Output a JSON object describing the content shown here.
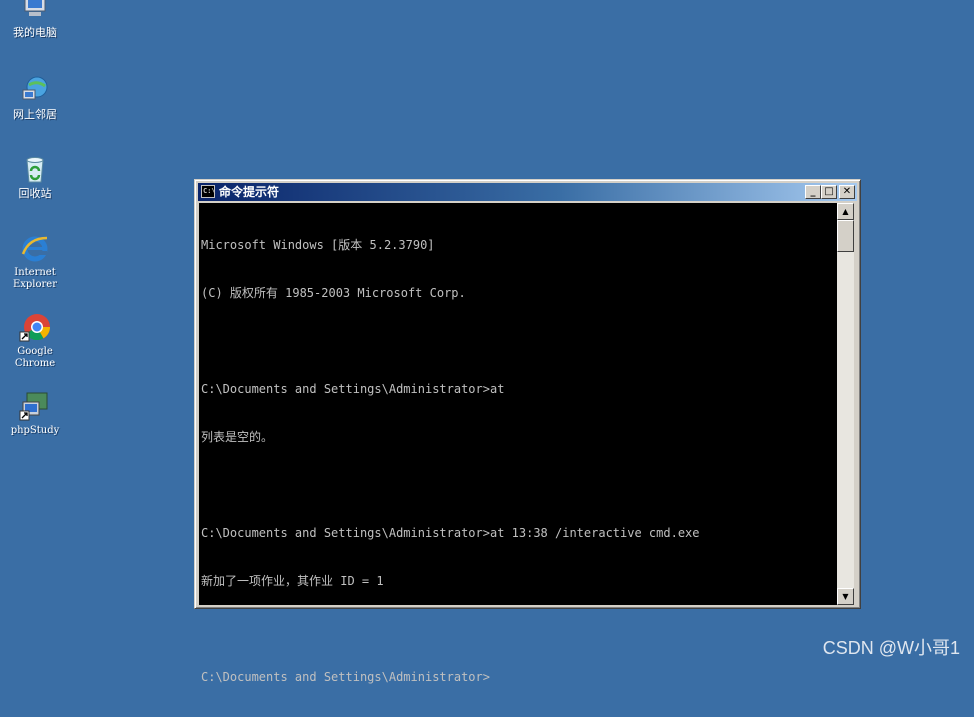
{
  "desktop": {
    "icons": [
      {
        "label": "我的电脑",
        "icon": "my-computer-icon"
      },
      {
        "label": "网上邻居",
        "icon": "network-places-icon"
      },
      {
        "label": "回收站",
        "icon": "recycle-bin-icon"
      },
      {
        "label_line1": "Internet",
        "label_line2": "Explorer",
        "icon": "internet-explorer-icon"
      },
      {
        "label_line1": "Google",
        "label_line2": "Chrome",
        "icon": "google-chrome-icon"
      },
      {
        "label": "phpStudy",
        "icon": "phpstudy-icon"
      }
    ]
  },
  "window": {
    "title": "命令提示符",
    "icon": "console-icon",
    "buttons": {
      "minimize": "_",
      "maximize": "□",
      "close": "✕"
    }
  },
  "console": {
    "lines": [
      "Microsoft Windows [版本 5.2.3790]",
      "(C) 版权所有 1985-2003 Microsoft Corp.",
      "",
      "C:\\Documents and Settings\\Administrator>at",
      "列表是空的。",
      "",
      "C:\\Documents and Settings\\Administrator>at 13:38 /interactive cmd.exe",
      "新加了一项作业，其作业 ID = 1",
      "",
      "C:\\Documents and Settings\\Administrator>"
    ]
  },
  "scrollbar": {
    "up": "▲",
    "down": "▼"
  },
  "watermark": "CSDN @W小哥1",
  "colors": {
    "desktop": "#3a6ea5",
    "title_start": "#0a246a",
    "console_bg": "#000000",
    "console_fg": "#c0c0c0"
  }
}
